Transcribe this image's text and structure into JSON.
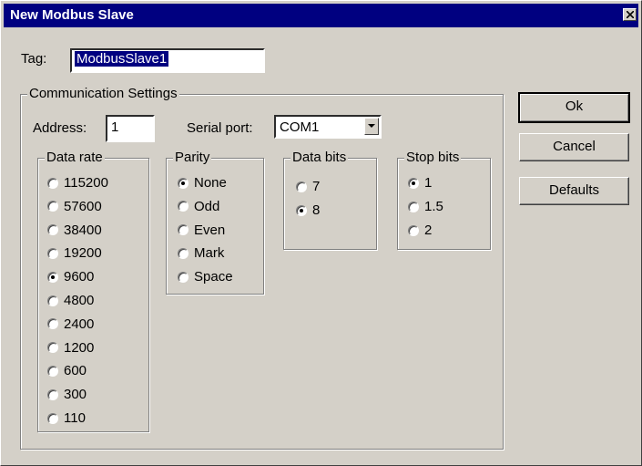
{
  "window": {
    "title": "New Modbus Slave"
  },
  "tag": {
    "label": "Tag:",
    "value": "ModbusSlave1"
  },
  "communication": {
    "group_label": "Communication Settings",
    "address_label": "Address:",
    "address_value": "1",
    "serial_port_label": "Serial port:",
    "serial_port_value": "COM1",
    "data_rate": {
      "label": "Data rate",
      "options": [
        "115200",
        "57600",
        "38400",
        "19200",
        "9600",
        "4800",
        "2400",
        "1200",
        "600",
        "300",
        "110"
      ],
      "selected": "9600"
    },
    "parity": {
      "label": "Parity",
      "options": [
        "None",
        "Odd",
        "Even",
        "Mark",
        "Space"
      ],
      "selected": "None"
    },
    "data_bits": {
      "label": "Data bits",
      "options": [
        "7",
        "8"
      ],
      "selected": "8"
    },
    "stop_bits": {
      "label": "Stop bits",
      "options": [
        "1",
        "1.5",
        "2"
      ],
      "selected": "1"
    }
  },
  "buttons": {
    "ok": "Ok",
    "cancel": "Cancel",
    "defaults": "Defaults"
  }
}
